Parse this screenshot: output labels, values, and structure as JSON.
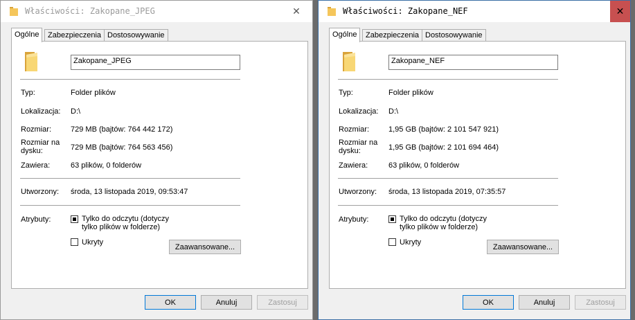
{
  "windows": [
    {
      "title": "Właściwości: Zakopane_JPEG",
      "tabs": [
        "Ogólne",
        "Zabezpieczenia",
        "Dostosowywanie"
      ],
      "name": "Zakopane_JPEG",
      "type_label": "Typ:",
      "type_value": "Folder plików",
      "location_label": "Lokalizacja:",
      "location_value": "D:\\",
      "size_label": "Rozmiar:",
      "size_value": "729 MB (bajtów: 764 442 172)",
      "size_on_disk_label_1": "Rozmiar na",
      "size_on_disk_label_2": "dysku:",
      "size_on_disk_value": "729 MB (bajtów: 764 563 456)",
      "contains_label": "Zawiera:",
      "contains_value": "63 plików, 0 folderów",
      "created_label": "Utworzony:",
      "created_value": "środa, 13 listopada 2019, 09:53:47",
      "attributes_label": "Atrybuty:",
      "readonly_label_1": "Tylko do odczytu (dotyczy",
      "readonly_label_2": "tylko plików w folderze)",
      "hidden_label": "Ukryty",
      "advanced_button": "Zaawansowane...",
      "ok_button": "OK",
      "cancel_button": "Anuluj",
      "apply_button": "Zastosuj"
    },
    {
      "title": "Właściwości: Zakopane_NEF",
      "tabs": [
        "Ogólne",
        "Zabezpieczenia",
        "Dostosowywanie"
      ],
      "name": "Zakopane_NEF",
      "type_label": "Typ:",
      "type_value": "Folder plików",
      "location_label": "Lokalizacja:",
      "location_value": "D:\\",
      "size_label": "Rozmiar:",
      "size_value": "1,95 GB (bajtów: 2 101 547 921)",
      "size_on_disk_label_1": "Rozmiar na",
      "size_on_disk_label_2": "dysku:",
      "size_on_disk_value": "1,95 GB (bajtów: 2 101 694 464)",
      "contains_label": "Zawiera:",
      "contains_value": "63 plików, 0 folderów",
      "created_label": "Utworzony:",
      "created_value": "środa, 13 listopada 2019, 07:35:57",
      "attributes_label": "Atrybuty:",
      "readonly_label_1": "Tylko do odczytu (dotyczy",
      "readonly_label_2": "tylko plików w folderze)",
      "hidden_label": "Ukryty",
      "advanced_button": "Zaawansowane...",
      "ok_button": "OK",
      "cancel_button": "Anuluj",
      "apply_button": "Zastosuj"
    }
  ],
  "icons": {
    "folder": "folder-icon",
    "close": "close-icon",
    "readonly_checkbox": "checkbox-indeterminate",
    "hidden_checkbox": "checkbox-unchecked"
  },
  "colors": {
    "folder": "#f5c65b",
    "close_active": "#c75050",
    "default_button_border": "#0078d7"
  }
}
